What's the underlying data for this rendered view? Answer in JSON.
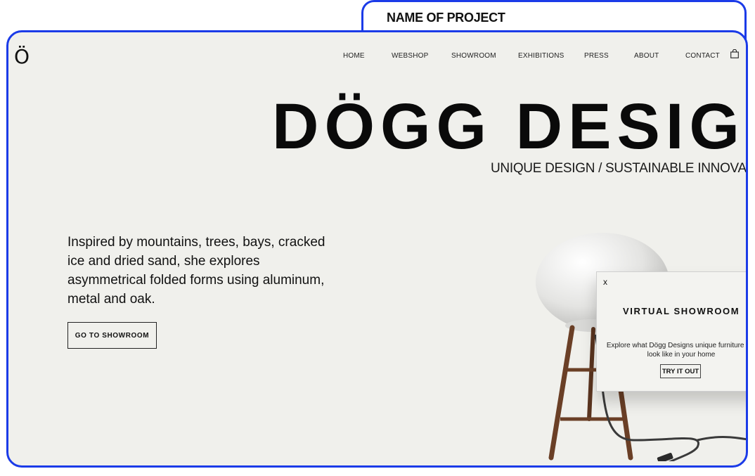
{
  "project_tab": {
    "title": "NAME OF PROJECT"
  },
  "site": {
    "logo": "Ö",
    "nav": [
      "HOME",
      "WEBSHOP",
      "SHOWROOM",
      "EXHIBITIONS",
      "PRESS",
      "ABOUT",
      "CONTACT"
    ],
    "cart_icon": "shopping-bag-icon"
  },
  "hero": {
    "title": "DÖGG DESIGN",
    "tagline": "UNIQUE DESIGN / SUSTAINABLE INNOVATI"
  },
  "intro": {
    "text": "Inspired by mountains, trees, bays, cracked ice and dried sand, she explores asymmetrical folded forms using aluminum, metal and oak.",
    "cta": "GO TO SHOWROOM"
  },
  "popup": {
    "close": "x",
    "title": "VIRTUAL SHOWROOM",
    "text": "Explore what Dögg Designs unique furniture will look like in your home",
    "button": "TRY IT OUT"
  },
  "colors": {
    "frame_border": "#1b3be8",
    "page_background": "#f0f0ec",
    "text": "#111111"
  }
}
